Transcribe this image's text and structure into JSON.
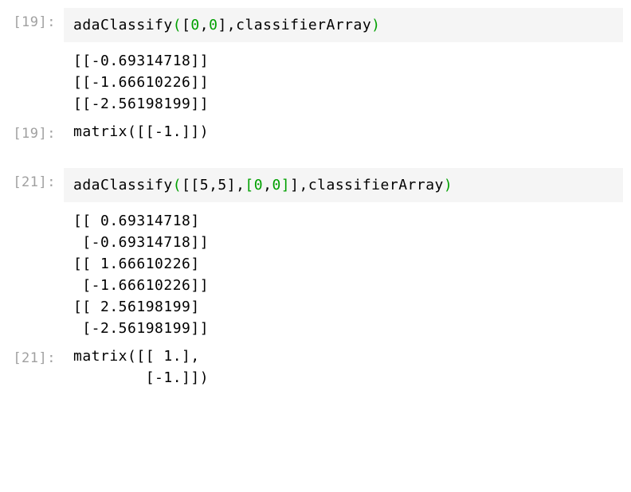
{
  "cells": [
    {
      "prompt_in": "[19]:",
      "code_html": "<span class='fn'>adaClassify</span><span class='paren'>(</span><span class='bracket'>[</span><span class='num'>0</span><span class='comma'>,</span><span class='num'>0</span><span class='bracket'>]</span><span class='comma'>,classifierArray</span><span class='paren'>)</span>",
      "print": "[[-0.69314718]]\n[[-1.66610226]]\n[[-2.56198199]]",
      "prompt_out": "[19]:",
      "result": "matrix([[-1.]])"
    },
    {
      "prompt_in": "[21]:",
      "code_html": "<span class='fn'>adaClassify</span><span class='paren'>(</span><span class='bracket'>[[5,5],</span><span class='bracket-green'>[</span><span class='num'>0</span><span class='comma'>,</span><span class='num'>0</span><span class='bracket-green'>]</span><span class='bracket'>]</span><span class='comma'>,classifierArray</span><span class='paren'>)</span>",
      "print": "[[ 0.69314718]\n [-0.69314718]]\n[[ 1.66610226]\n [-1.66610226]]\n[[ 2.56198199]\n [-2.56198199]]",
      "prompt_out": "[21]:",
      "result": "matrix([[ 1.],\n        [-1.]])"
    }
  ]
}
